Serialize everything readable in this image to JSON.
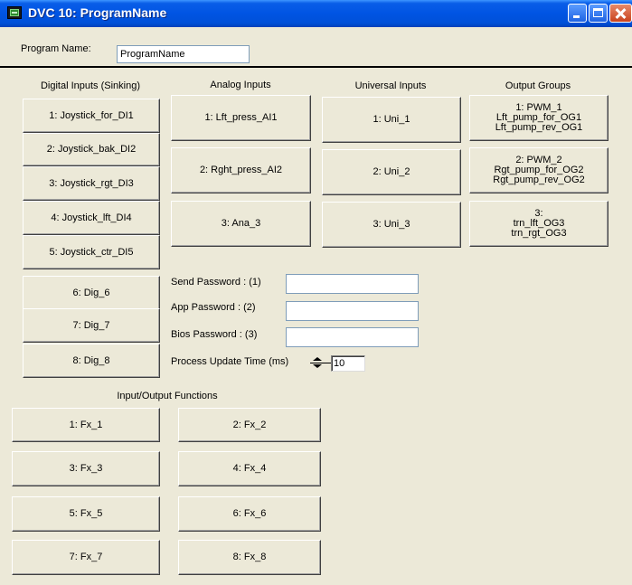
{
  "window": {
    "title": "DVC 10: ProgramName"
  },
  "program": {
    "label": "Program Name:",
    "value": "ProgramName"
  },
  "digital_inputs": {
    "heading": "Digital Inputs (Sinking)",
    "items": [
      "1: Joystick_for_DI1",
      "2: Joystick_bak_DI2",
      "3: Joystick_rgt_DI3",
      "4: Joystick_lft_DI4",
      "5: Joystick_ctr_DI5",
      "6: Dig_6",
      "7: Dig_7",
      "8: Dig_8"
    ]
  },
  "analog_inputs": {
    "heading": "Analog Inputs",
    "items": [
      "1: Lft_press_AI1",
      "2: Rght_press_AI2",
      "3: Ana_3"
    ]
  },
  "universal_inputs": {
    "heading": "Universal Inputs",
    "items": [
      "1: Uni_1",
      "2: Uni_2",
      "3: Uni_3"
    ]
  },
  "output_groups": {
    "heading": "Output Groups",
    "items": [
      {
        "line1": "1: PWM_1",
        "line2": "Lft_pump_for_OG1",
        "line3": "Lft_pump_rev_OG1"
      },
      {
        "line1": "2: PWM_2",
        "line2": "Rgt_pump_for_OG2",
        "line3": "Rgt_pump_rev_OG2"
      },
      {
        "line1": "3:",
        "line2": "trn_lft_OG3",
        "line3": "trn_rgt_OG3"
      }
    ]
  },
  "passwords": {
    "send_label": "Send Password : (1)",
    "send_value": "",
    "app_label": "App Password : (2)",
    "app_value": "",
    "bios_label": "Bios Password : (3)",
    "bios_value": ""
  },
  "process_update": {
    "label": "Process Update Time (ms)",
    "value": "10"
  },
  "io_functions": {
    "heading": "Input/Output Functions",
    "items": [
      "1: Fx_1",
      "2: Fx_2",
      "3: Fx_3",
      "4: Fx_4",
      "5: Fx_5",
      "6: Fx_6",
      "7: Fx_7",
      "8: Fx_8"
    ]
  }
}
